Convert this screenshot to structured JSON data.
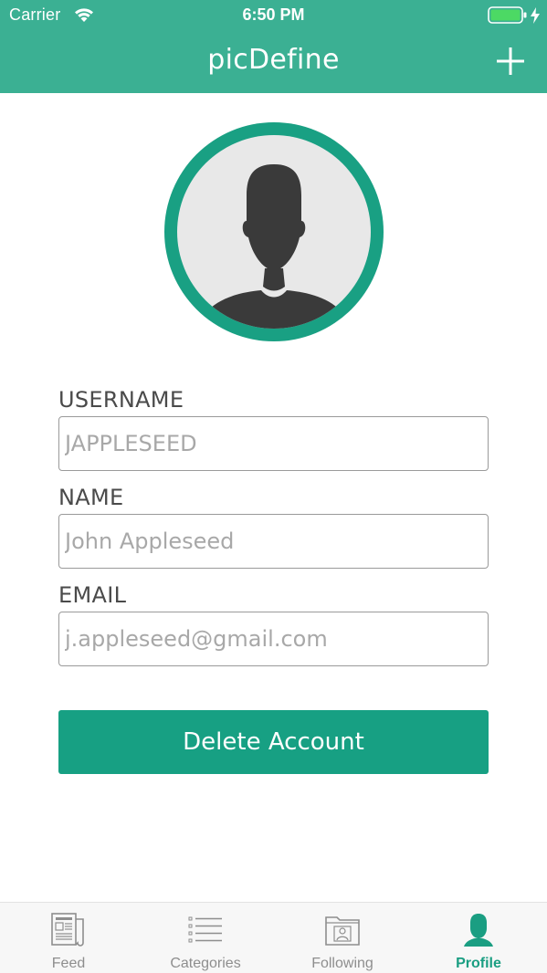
{
  "status_bar": {
    "carrier": "Carrier",
    "time": "6:50 PM",
    "wifi_icon": "wifi-icon",
    "battery_icon": "battery-icon",
    "charging_icon": "bolt-icon"
  },
  "nav": {
    "title": "picDefine",
    "add_icon": "plus-icon"
  },
  "profile": {
    "avatar_icon": "person-silhouette-icon"
  },
  "form": {
    "username": {
      "label": "USERNAME",
      "placeholder": "JAPPLESEED"
    },
    "name": {
      "label": "NAME",
      "placeholder": "John Appleseed"
    },
    "email": {
      "label": "EMAIL",
      "placeholder": "j.appleseed@gmail.com"
    }
  },
  "actions": {
    "delete_label": "Delete Account"
  },
  "tabs": [
    {
      "label": "Feed",
      "icon": "newspaper-icon",
      "active": false
    },
    {
      "label": "Categories",
      "icon": "list-icon",
      "active": false
    },
    {
      "label": "Following",
      "icon": "folder-person-icon",
      "active": false
    },
    {
      "label": "Profile",
      "icon": "person-icon",
      "active": true
    }
  ],
  "colors": {
    "header": "#3bb093",
    "accent": "#17a083",
    "tab_active": "#1a9e82",
    "tab_inactive": "#8e8e8e"
  }
}
